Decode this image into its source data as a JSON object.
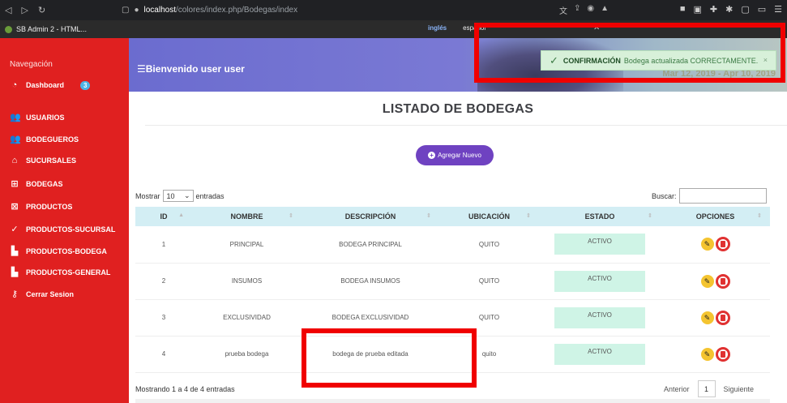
{
  "browser": {
    "url_host": "localhost",
    "url_path": "/colores/index.php/Bodegas/index",
    "tab_title": "SB Admin 2 - HTML...",
    "translate_lang1": "inglés",
    "translate_lang2": "español",
    "translate_close": "✕"
  },
  "sidebar": {
    "heading": "Navegación",
    "dashboard": {
      "label": "Dashboard",
      "badge": "3"
    },
    "items": [
      {
        "label": "USUARIOS",
        "icon": "users-icon"
      },
      {
        "label": "BODEGUEROS",
        "icon": "users-icon"
      },
      {
        "label": "SUCURSALES",
        "icon": "home-icon"
      },
      {
        "label": "BODEGAS",
        "icon": "grid-icon"
      },
      {
        "label": "PRODUCTOS",
        "icon": "box-x-icon"
      },
      {
        "label": "PRODUCTOS-SUCURSAL",
        "icon": "check-icon"
      },
      {
        "label": "PRODUCTOS-BODEGA",
        "icon": "factory-icon"
      },
      {
        "label": "PRODUCTOS-GENERAL",
        "icon": "factory-icon"
      },
      {
        "label": "Cerrar Sesion",
        "icon": "key-icon"
      }
    ]
  },
  "header": {
    "welcome": "Bienvenido user user",
    "dates_faint": "Mar 12, 2019 - Apr 10, 2019"
  },
  "toast": {
    "strong": "CONFIRMACIÓN",
    "message": "Bodega actualizada CORRECTAMENTE.",
    "close": "×"
  },
  "page": {
    "title": "LISTADO DE BODEGAS",
    "add_button": "Agregar Nuevo",
    "len_prefix": "Mostrar",
    "len_value": "10",
    "len_suffix": "entradas",
    "search_label": "Buscar:",
    "info": "Mostrando 1 a 4 de 4 entradas",
    "prev": "Anterior",
    "page": "1",
    "next": "Siguiente"
  },
  "table": {
    "headers": [
      "ID",
      "NOMBRE",
      "DESCRIPCIÓN",
      "UBICACIÓN",
      "ESTADO",
      "OPCIONES"
    ],
    "rows": [
      {
        "id": "1",
        "nombre": "PRINCIPAL",
        "descripcion": "BODEGA PRINCIPAL",
        "ubicacion": "QUITO",
        "estado": "ACTIVO"
      },
      {
        "id": "2",
        "nombre": "INSUMOS",
        "descripcion": "BODEGA INSUMOS",
        "ubicacion": "QUITO",
        "estado": "ACTIVO"
      },
      {
        "id": "3",
        "nombre": "EXCLUSIVIDAD",
        "descripcion": "BODEGA EXCLUSIVIDAD",
        "ubicacion": "QUITO",
        "estado": "ACTIVO"
      },
      {
        "id": "4",
        "nombre": "prueba bodega",
        "descripcion": "bodega de prueba editada",
        "ubicacion": "quito",
        "estado": "ACTIVO"
      }
    ]
  },
  "colors": {
    "sidebar": "#e02020",
    "accent": "#6f42c1",
    "highlight": "#f00000"
  }
}
